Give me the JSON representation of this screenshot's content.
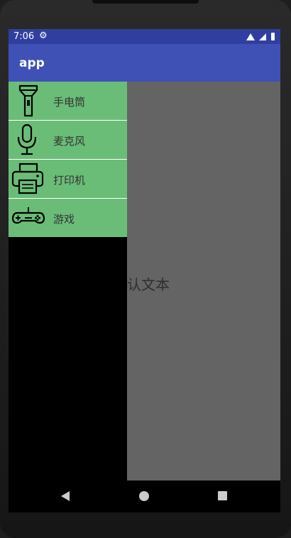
{
  "status_bar": {
    "time": "7:06",
    "settings_icon": "gear-icon",
    "wifi_icon": "wifi-icon",
    "signal_icon": "signal-icon",
    "battery_icon": "battery-icon"
  },
  "app_bar": {
    "title": "app"
  },
  "drawer": {
    "items": [
      {
        "label": "手电筒",
        "icon": "flashlight-icon"
      },
      {
        "label": "麦克风",
        "icon": "microphone-icon"
      },
      {
        "label": "打印机",
        "icon": "printer-icon"
      },
      {
        "label": "游戏",
        "icon": "gamepad-icon"
      }
    ]
  },
  "content": {
    "default_text": "认文本"
  },
  "nav_bar": {
    "back": "back-icon",
    "home": "home-icon",
    "recents": "recents-icon"
  },
  "colors": {
    "status_bar": "#303f9f",
    "app_bar": "#3f51b5",
    "drawer_item": "#6abd77",
    "content_bg": "#646464"
  }
}
